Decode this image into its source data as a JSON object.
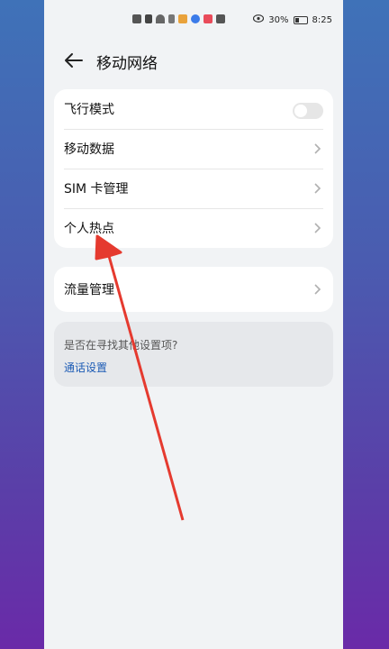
{
  "status_bar": {
    "battery": "30%",
    "time": "8:25"
  },
  "header": {
    "title": "移动网络"
  },
  "card1": {
    "items": [
      {
        "label": "飞行模式",
        "control": "toggle",
        "value": false
      },
      {
        "label": "移动数据",
        "control": "chevron"
      },
      {
        "label": "SIM 卡管理",
        "control": "chevron"
      },
      {
        "label": "个人热点",
        "control": "chevron"
      }
    ]
  },
  "card2": {
    "items": [
      {
        "label": "流量管理",
        "control": "chevron"
      }
    ]
  },
  "hint": {
    "question": "是否在寻找其他设置项?",
    "link": "通话设置"
  },
  "annotation": {
    "color": "#e53a2f"
  }
}
